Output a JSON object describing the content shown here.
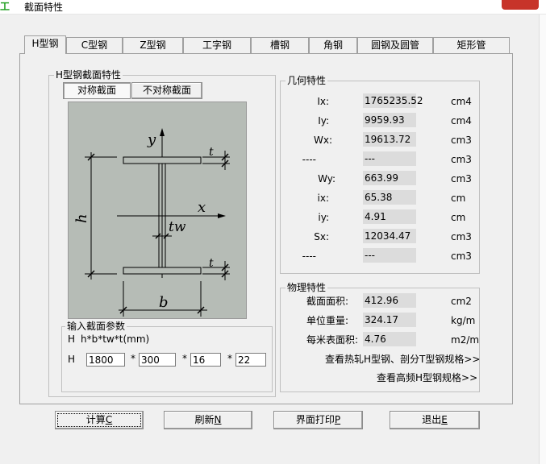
{
  "window": {
    "title": "截面特性",
    "app_icon": "section-app-icon"
  },
  "tabs": [
    {
      "label": "H型钢",
      "active": true
    },
    {
      "label": "C型钢",
      "active": false
    },
    {
      "label": "Z型钢",
      "active": false
    },
    {
      "label": "工字钢",
      "active": false
    },
    {
      "label": "槽钢",
      "active": false
    },
    {
      "label": "角钢",
      "active": false
    },
    {
      "label": "圆钢及圆管",
      "active": false
    },
    {
      "label": "矩形管",
      "active": false
    }
  ],
  "section_group": {
    "legend": "H型钢截面特性",
    "sym_button": "对称截面",
    "asym_button": "不对称截面"
  },
  "diagram_labels": {
    "y": "y",
    "x": "x",
    "h": "h",
    "tw": "tw",
    "t_top": "t",
    "t_bottom": "t",
    "b": "b"
  },
  "input_group": {
    "legend": "输入截面参数",
    "prefix1": "H",
    "formula": "h*b*tw*t(mm)",
    "prefix2": "H",
    "sep": "*",
    "h": "1800",
    "b": "300",
    "tw": "16",
    "t": "22"
  },
  "geometry": {
    "legend": "几何特性",
    "rows": [
      {
        "label": "Ix:",
        "value": "1765235.52",
        "unit": "cm4"
      },
      {
        "label": "Iy:",
        "value": "9959.93",
        "unit": "cm4"
      },
      {
        "label": "Wx:",
        "value": "19613.72",
        "unit": "cm3"
      },
      {
        "label": "----",
        "value": "---",
        "unit": "cm3"
      },
      {
        "label": "Wy:",
        "value": "663.99",
        "unit": "cm3"
      },
      {
        "label": "ix:",
        "value": "65.38",
        "unit": "cm"
      },
      {
        "label": "iy:",
        "value": "4.91",
        "unit": "cm"
      },
      {
        "label": "Sx:",
        "value": "12034.47",
        "unit": "cm3"
      },
      {
        "label": "----",
        "value": "---",
        "unit": "cm3"
      }
    ]
  },
  "physical": {
    "legend": "物理特性",
    "rows": [
      {
        "label": "截面面积:",
        "value": "412.96",
        "unit": "cm2"
      },
      {
        "label": "单位重量:",
        "value": "324.17",
        "unit": "kg/m"
      },
      {
        "label": "每米表面积:",
        "value": "4.76",
        "unit": "m2/m"
      }
    ],
    "link1": "查看热轧H型钢、剖分T型钢规格>>",
    "link2": "查看高频H型钢规格>>"
  },
  "buttons": {
    "calc": {
      "text": "计算",
      "key": "C"
    },
    "refresh": {
      "text": "刷新",
      "key": "N"
    },
    "print": {
      "text": "界面打印",
      "key": "P"
    },
    "exit": {
      "text": "退出",
      "key": "E"
    }
  }
}
